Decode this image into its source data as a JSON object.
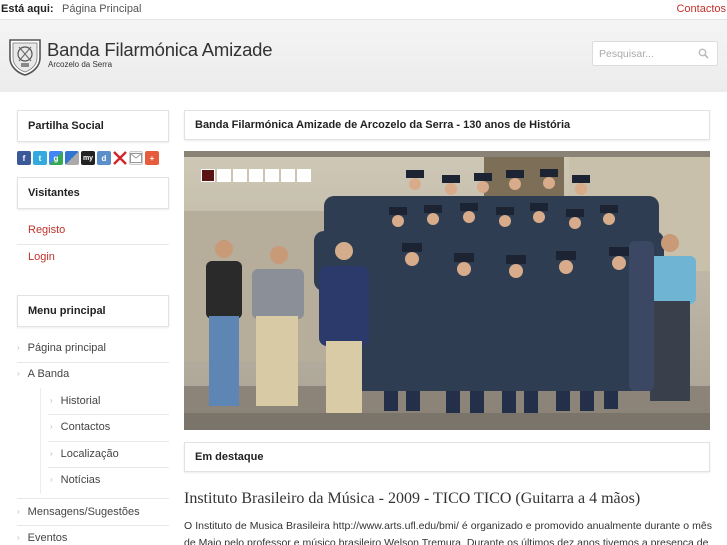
{
  "topbar": {
    "breadcrumb_label": "Está aqui:",
    "breadcrumb_home": "Página Principal",
    "contacts": "Contactos"
  },
  "header": {
    "title": "Banda Filarmónica Amizade",
    "subtitle": "Arcozelo da Serra",
    "search_placeholder": "Pesquisar..."
  },
  "sidebar": {
    "social": {
      "title": "Partilha Social",
      "icons": [
        "facebook-icon",
        "twitter-icon",
        "google-icon",
        "delicious-icon",
        "myspace-icon",
        "digg-icon",
        "close-icon",
        "email-icon",
        "plus-icon"
      ]
    },
    "visitors": {
      "title": "Visitantes",
      "links": [
        "Registo",
        "Login"
      ]
    },
    "menu": {
      "title": "Menu principal",
      "items": [
        {
          "label": "Página principal",
          "level": 1
        },
        {
          "label": "A Banda",
          "level": 1
        },
        {
          "label": "Historial",
          "level": 2
        },
        {
          "label": "Contactos",
          "level": 2
        },
        {
          "label": "Localização",
          "level": 2
        },
        {
          "label": "Notícias",
          "level": 2
        },
        {
          "label": "Mensagens/Sugestões",
          "level": 1
        },
        {
          "label": "Eventos",
          "level": 1
        }
      ]
    }
  },
  "main": {
    "slideshow_title": "Banda Filarmónica Amizade de Arcozelo da Serra - 130 anos de História",
    "slideshow": {
      "count": 7,
      "active_index": 0
    },
    "featured_title": "Em destaque",
    "article": {
      "title": "Instituto Brasileiro da Música - 2009 - TICO TICO (Guitarra a 4 mãos)",
      "text": "O Instituto de Musica Brasileira http://www.arts.ufl.edu/bmi/ é organizado e promovido anualmente durante o mês de Maio pelo professor e músico brasileiro Welson Tremura. Durante os últimos dez anos tivemos a presença de"
    }
  },
  "colors": {
    "accent_red": "#c0322b",
    "header_bg": "#efefef",
    "border": "#e2e2e2"
  }
}
